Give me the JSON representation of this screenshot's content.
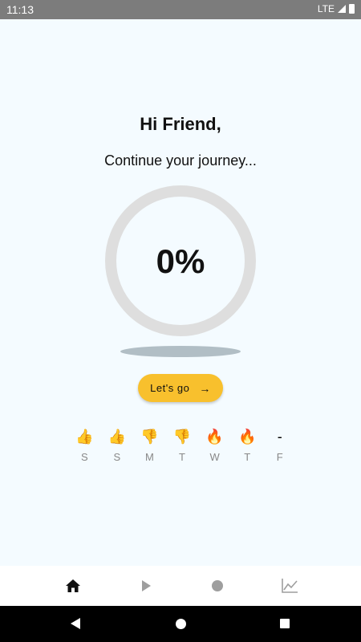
{
  "status_bar": {
    "time": "11:13",
    "network": "LTE"
  },
  "greeting": "Hi Friend,",
  "subtitle": "Continue your journey...",
  "progress": {
    "label": "0%",
    "value": 0
  },
  "cta": {
    "label": "Let's go",
    "arrow": "→"
  },
  "week": [
    {
      "letter": "S",
      "icon": "👍",
      "icon_name": "thumbs-up-icon"
    },
    {
      "letter": "S",
      "icon": "👍",
      "icon_name": "thumbs-up-icon"
    },
    {
      "letter": "M",
      "icon": "👎",
      "icon_name": "thumbs-down-icon"
    },
    {
      "letter": "T",
      "icon": "👎",
      "icon_name": "thumbs-down-icon"
    },
    {
      "letter": "W",
      "icon": "🔥",
      "icon_name": "fire-icon"
    },
    {
      "letter": "T",
      "icon": "🔥",
      "icon_name": "fire-icon"
    },
    {
      "letter": "F",
      "icon": "-",
      "icon_name": "dash-icon"
    }
  ],
  "bottom_nav": [
    "home-icon",
    "play-icon",
    "record-icon",
    "chart-icon"
  ],
  "colors": {
    "background": "#f4fbff",
    "accent": "#f8c02d",
    "ring": "#dedede",
    "nav_active": "#111111",
    "nav_inactive": "#9e9e9e"
  }
}
